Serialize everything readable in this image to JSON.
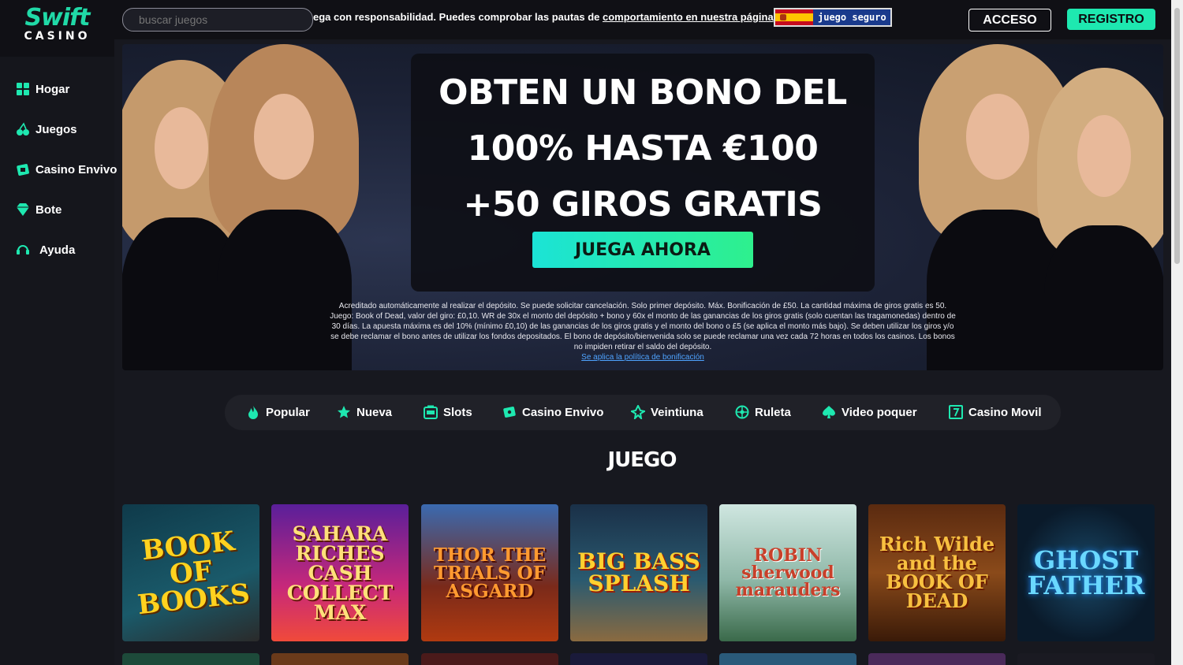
{
  "header": {
    "logo_top": "Swift",
    "logo_bottom": "CASINO",
    "search_placeholder": "buscar juegos",
    "notice_text": "ega con responsabilidad. Puedes comprobar las pautas de ",
    "notice_link": "comportamiento en nuestra página",
    "notice_end": ".",
    "safe_badge": "juego seguro",
    "login_label": "ACCESO",
    "register_label": "REGISTRO"
  },
  "sidebar": {
    "items": [
      {
        "label": "Hogar",
        "icon": "grid-icon"
      },
      {
        "label": "Juegos",
        "icon": "cherry-icon"
      },
      {
        "label": "Casino Envivo",
        "icon": "live-icon"
      },
      {
        "label": "Bote",
        "icon": "diamond-icon"
      },
      {
        "label": "Ayuda",
        "icon": "headset-icon"
      }
    ]
  },
  "hero": {
    "line1": "OBTEN UN BONO DEL",
    "line2": "100% HASTA €100",
    "line3": "+50 GIROS GRATIS",
    "cta": "JUEGA AHORA",
    "terms": "Acreditado automáticamente al realizar el depósito. Se puede solicitar cancelación. Solo primer depósito. Máx. Bonificación de £50. La cantidad máxima de giros gratis es 50. Juego: Book of Dead, valor del giro: £0,10. WR de 30x el monto del depósito + bono y 60x el monto de las ganancias de los giros gratis (solo cuentan las tragamonedas) dentro de 30 días. La apuesta máxima es del 10% (mínimo £0,10) de las ganancias de los giros gratis y el monto del bono o £5 (se aplica el monto más bajo). Se deben utilizar los giros y/o se debe reclamar el bono antes de utilizar los fondos depositados. El bono de depósito/bienvenida solo se puede reclamar una vez cada 72 horas en todos los casinos. Los bonos no impiden retirar el saldo del depósito.",
    "terms_link": "Se aplica la política de bonificación"
  },
  "categories": [
    {
      "label": "Popular",
      "icon": "flame-icon"
    },
    {
      "label": "Nueva",
      "icon": "star-icon"
    },
    {
      "label": "Slots",
      "icon": "slot-machine-icon"
    },
    {
      "label": "Casino Envivo",
      "icon": "live-icon"
    },
    {
      "label": "Veintiuna",
      "icon": "blackjack-icon"
    },
    {
      "label": "Ruleta",
      "icon": "roulette-icon"
    },
    {
      "label": "Video poquer",
      "icon": "spade-icon"
    },
    {
      "label": "Casino Movil",
      "icon": "mobile-icon"
    }
  ],
  "section_title": "JUEGO",
  "games": [
    {
      "title": "BOOK OF BOOKS"
    },
    {
      "title": "SAHARA RICHES CASH COLLECT MAX"
    },
    {
      "title": "THOR THE TRIALS OF ASGARD"
    },
    {
      "title": "BIG BASS SPLASH"
    },
    {
      "title": "ROBIN sherwood marauders"
    },
    {
      "title": "Rich Wilde and the BOOK OF DEAD"
    },
    {
      "title": "GHOST FATHER"
    }
  ],
  "colors": {
    "accent": "#1ee8b0",
    "background": "#17181f",
    "sidebar": "#15161c",
    "link": "#4ea3ff"
  }
}
